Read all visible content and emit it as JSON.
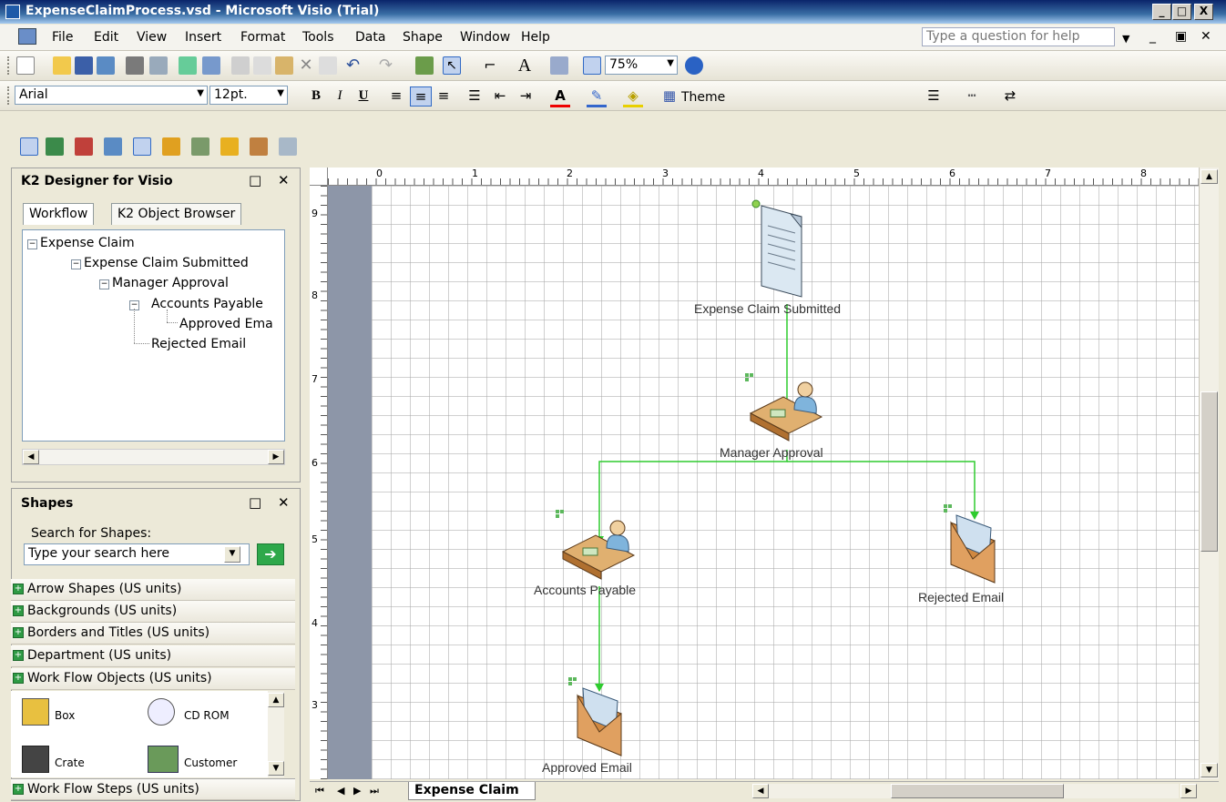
{
  "window": {
    "title": "ExpenseClaimProcess.vsd - Microsoft Visio (Trial)",
    "minimize": "_",
    "restore": "□",
    "close": "X"
  },
  "menu": {
    "items": [
      "File",
      "Edit",
      "View",
      "Insert",
      "Format",
      "Tools",
      "Data",
      "Shape",
      "Window",
      "Help"
    ],
    "help_placeholder": "Type a question for help"
  },
  "standard_toolbar": {
    "zoom": "75%"
  },
  "format_toolbar": {
    "font": "Arial",
    "size": "12pt.",
    "bold": "B",
    "italic": "I",
    "underline": "U",
    "theme_label": "Theme"
  },
  "k2_panel": {
    "title": "K2 Designer for Visio",
    "tabs": [
      "Workflow",
      "K2 Object Browser"
    ],
    "tree": [
      {
        "label": "Expense Claim",
        "level": 0,
        "expander": "−"
      },
      {
        "label": "Expense Claim Submitted",
        "level": 1,
        "expander": "−"
      },
      {
        "label": "Manager Approval",
        "level": 2,
        "expander": "−"
      },
      {
        "label": "Accounts Payable",
        "level": 3,
        "expander": "−"
      },
      {
        "label": "Approved Ema",
        "level": 4,
        "expander": ""
      },
      {
        "label": "Rejected Email",
        "level": 3,
        "expander": ""
      }
    ]
  },
  "shapes_panel": {
    "title": "Shapes",
    "search_label": "Search for Shapes:",
    "search_placeholder": "Type your search here",
    "stencils": [
      "Arrow Shapes (US units)",
      "Backgrounds (US units)",
      "Borders and Titles (US units)",
      "Department (US units)",
      "Work Flow Objects (US units)"
    ],
    "shape_items": [
      "Box",
      "CD ROM",
      "Crate",
      "Customer"
    ],
    "bottom_stencil": "Work Flow Steps (US units)"
  },
  "ruler": {
    "h_labels": [
      "0",
      "1",
      "2",
      "3",
      "4",
      "5",
      "6",
      "7",
      "8"
    ],
    "v_labels": [
      "9",
      "8",
      "7",
      "6",
      "5",
      "4",
      "3"
    ]
  },
  "diagram": {
    "nodes": [
      {
        "id": "submitted",
        "label": "Expense Claim Submitted",
        "icon": "document-icon"
      },
      {
        "id": "manager",
        "label": "Manager Approval",
        "icon": "person-at-desk-icon"
      },
      {
        "id": "accounts",
        "label": "Accounts Payable",
        "icon": "person-at-desk-icon"
      },
      {
        "id": "rejected",
        "label": "Rejected Email",
        "icon": "envelope-icon"
      },
      {
        "id": "approved",
        "label": "Approved Email",
        "icon": "envelope-icon"
      }
    ],
    "connectors": [
      {
        "from": "submitted",
        "to": "manager"
      },
      {
        "from": "manager",
        "to": "accounts"
      },
      {
        "from": "manager",
        "to": "rejected"
      },
      {
        "from": "accounts",
        "to": "approved"
      }
    ],
    "connector_color": "#2ecc2e"
  },
  "page_tabs": {
    "active": "Expense Claim"
  }
}
